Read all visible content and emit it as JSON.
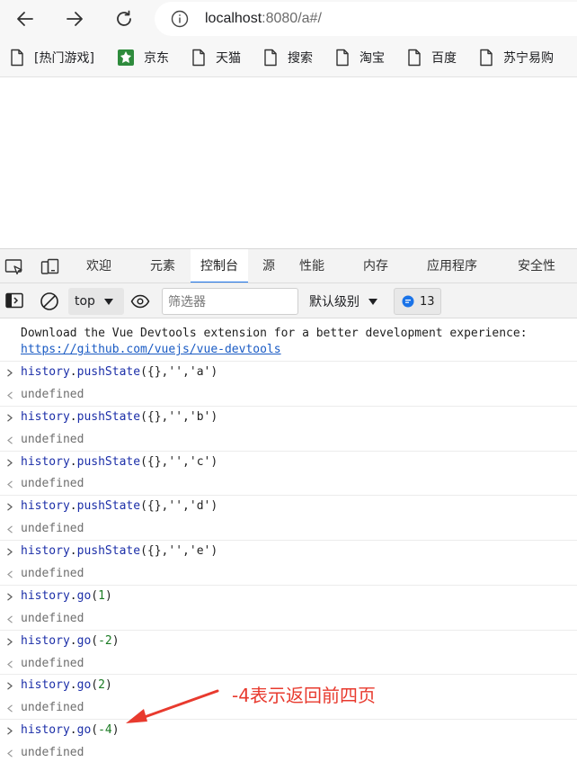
{
  "browser": {
    "address": {
      "host": "localhost",
      "path": ":8080/a#/"
    },
    "bookmarks": [
      {
        "label": "[热门游戏]",
        "icon": "page-icon"
      },
      {
        "label": "京东",
        "icon": "jd-logo-icon"
      },
      {
        "label": "天猫",
        "icon": "page-icon"
      },
      {
        "label": "搜索",
        "icon": "page-icon"
      },
      {
        "label": "淘宝",
        "icon": "page-icon"
      },
      {
        "label": "百度",
        "icon": "page-icon"
      },
      {
        "label": "苏宁易购",
        "icon": "page-icon"
      }
    ]
  },
  "devtools": {
    "tabs": [
      "欢迎",
      "元素",
      "控制台",
      "源",
      "性能",
      "内存",
      "应用程序",
      "安全性"
    ],
    "active_tab": "控制台",
    "toolbar": {
      "context": "top",
      "filter_placeholder": "筛选器",
      "level": "默认级别",
      "message_count": "13"
    }
  },
  "console": {
    "intro_text": "Download the Vue Devtools extension for a better development experience:",
    "intro_link": "https://github.com/vuejs/vue-devtools",
    "entries": [
      {
        "object": "history",
        "method": "pushState",
        "open": "({},",
        "str1": "''",
        "comma": ",",
        "arg": "'a'",
        "close": ")",
        "result": "undefined"
      },
      {
        "object": "history",
        "method": "pushState",
        "open": "({},",
        "str1": "''",
        "comma": ",",
        "arg": "'b'",
        "close": ")",
        "result": "undefined"
      },
      {
        "object": "history",
        "method": "pushState",
        "open": "({},",
        "str1": "''",
        "comma": ",",
        "arg": "'c'",
        "close": ")",
        "result": "undefined"
      },
      {
        "object": "history",
        "method": "pushState",
        "open": "({},",
        "str1": "''",
        "comma": ",",
        "arg": "'d'",
        "close": ")",
        "result": "undefined"
      },
      {
        "object": "history",
        "method": "pushState",
        "open": "({},",
        "str1": "''",
        "comma": ",",
        "arg": "'e'",
        "close": ")",
        "result": "undefined"
      },
      {
        "object": "history",
        "method": "go",
        "open": "(",
        "num": "1",
        "close": ")",
        "result": "undefined"
      },
      {
        "object": "history",
        "method": "go",
        "open": "(",
        "num": "-2",
        "close": ")",
        "result": "undefined"
      },
      {
        "object": "history",
        "method": "go",
        "open": "(",
        "num": "2",
        "close": ")",
        "result": "undefined"
      },
      {
        "object": "history",
        "method": "go",
        "open": "(",
        "num": "-4",
        "close": ")",
        "result": "undefined"
      }
    ]
  },
  "annotation": {
    "text": "-4表示返回前四页",
    "color": "#e83a2e"
  },
  "colors": {
    "link": "#1a5bc4",
    "identifier": "#1b2ea8",
    "number": "#1a7a23",
    "tab_underline": "#1a73e8"
  }
}
